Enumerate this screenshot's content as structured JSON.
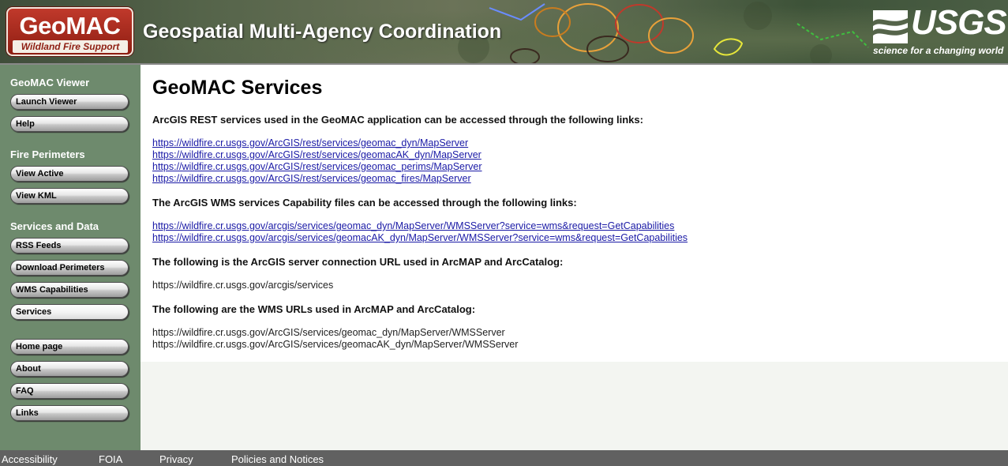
{
  "header": {
    "logo_main": "GeoMAC",
    "logo_sub": "Wildland Fire Support",
    "site_title": "Geospatial Multi-Agency Coordination",
    "usgs_word": "USGS",
    "usgs_tagline": "science for a changing world"
  },
  "sidebar": {
    "sections": [
      {
        "heading": "GeoMAC Viewer",
        "items": [
          "Launch Viewer",
          "Help"
        ]
      },
      {
        "heading": "Fire Perimeters",
        "items": [
          "View Active",
          "View KML"
        ]
      },
      {
        "heading": "Services and Data",
        "items": [
          "RSS Feeds",
          "Download Perimeters",
          "WMS Capabilities",
          "Services"
        ]
      },
      {
        "heading": "",
        "items": [
          "Home page",
          "About",
          "FAQ",
          "Links"
        ]
      }
    ]
  },
  "main": {
    "title": "GeoMAC Services",
    "rest_intro": "ArcGIS REST services used in the GeoMAC application can be accessed through the following links:",
    "rest_links": [
      "https://wildfire.cr.usgs.gov/ArcGIS/rest/services/geomac_dyn/MapServer",
      "https://wildfire.cr.usgs.gov/ArcGIS/rest/services/geomacAK_dyn/MapServer",
      "https://wildfire.cr.usgs.gov/ArcGIS/rest/services/geomac_perims/MapServer",
      "https://wildfire.cr.usgs.gov/ArcGIS/rest/services/geomac_fires/MapServer"
    ],
    "wms_intro": "The ArcGIS WMS services Capability files can be accessed through the following links:",
    "wms_links": [
      "https://wildfire.cr.usgs.gov/arcgis/services/geomac_dyn/MapServer/WMSServer?service=wms&request=GetCapabilities",
      "https://wildfire.cr.usgs.gov/arcgis/services/geomacAK_dyn/MapServer/WMSServer?service=wms&request=GetCapabilities"
    ],
    "server_intro": "The following is the ArcGIS server connection URL used in ArcMAP and ArcCatalog:",
    "server_url": "https://wildfire.cr.usgs.gov/arcgis/services",
    "wms_urls_intro": "The following are the WMS URLs used in ArcMAP and ArcCatalog:",
    "wms_urls": [
      "https://wildfire.cr.usgs.gov/ArcGIS/services/geomac_dyn/MapServer/WMSServer",
      "https://wildfire.cr.usgs.gov/ArcGIS/services/geomacAK_dyn/MapServer/WMSServer"
    ]
  },
  "footer": {
    "links": [
      "Accessibility",
      "FOIA",
      "Privacy",
      "Policies and Notices"
    ]
  },
  "colors": {
    "sidebar_bg": "#6e8a6d",
    "link": "#1a1aa6",
    "logo_red": "#c0392b",
    "footer_bg": "#616161"
  }
}
